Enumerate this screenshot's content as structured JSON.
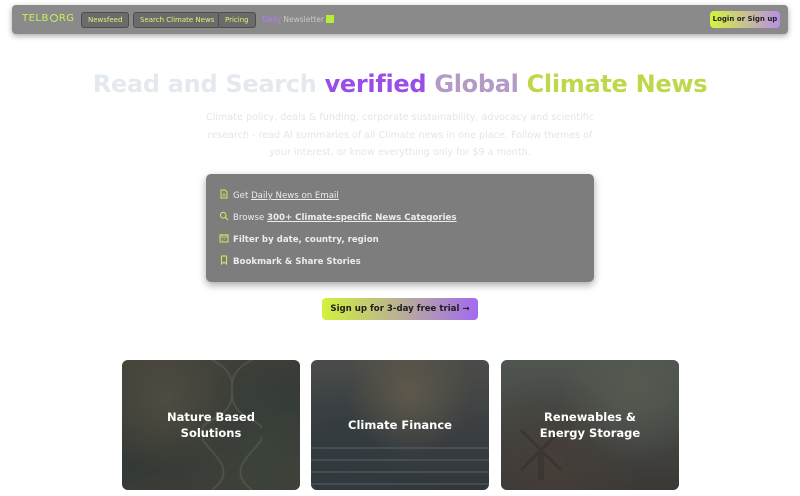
{
  "nav": {
    "logo": "TELB",
    "logo_tail": "RG",
    "items": [
      {
        "label": "Newsfeed"
      },
      {
        "label": "Search Climate News"
      },
      {
        "label": "Pricing"
      }
    ],
    "newsletter_label_a": "Daily",
    "newsletter_label_b": "Newsletter",
    "login_label": "Login or Sign up"
  },
  "hero": {
    "title_part1": "Read and Search ",
    "title_part2": "verified",
    "title_part3": " Global ",
    "title_part4": "Climate News",
    "subtitle": "Climate policy, deals & funding, corporate sustainability, advocacy and scientific research - read AI summaries of all Climate news in one place. Follow themes of your interest, or know everything only for $9 a month."
  },
  "features": [
    {
      "icon": "document-icon",
      "prefix": "Get ",
      "link": "Daily News on Email",
      "suffix": ""
    },
    {
      "icon": "search-icon",
      "prefix": "Browse ",
      "link": "300+ Climate-specific News Categories",
      "suffix": ""
    },
    {
      "icon": "calendar-icon",
      "prefix": "",
      "link": "",
      "suffix": "Filter by date, country, region"
    },
    {
      "icon": "bookmark-icon",
      "prefix": "",
      "link": "",
      "suffix": "Bookmark & Share Stories"
    }
  ],
  "cta": {
    "label": "Sign up for 3-day free trial →"
  },
  "cards": [
    {
      "line1": "Nature Based",
      "line2": "Solutions"
    },
    {
      "line1": "Climate Finance",
      "line2": ""
    },
    {
      "line1": "Renewables &",
      "line2": "Energy Storage"
    }
  ],
  "colors": {
    "accent_green": "#c8f05a",
    "accent_purple": "#9a4ee8",
    "nav_bg": "#8a8a8a",
    "feature_bg": "#7d7d7d"
  }
}
